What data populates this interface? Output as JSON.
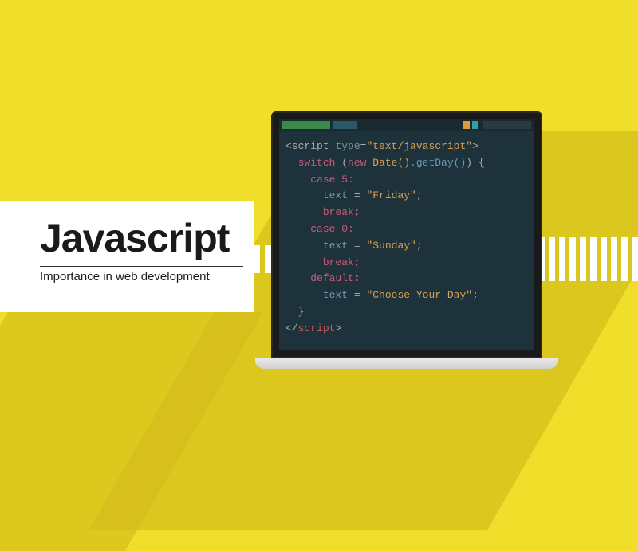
{
  "title": "Javascript",
  "subtitle": "Importance in web development",
  "code": {
    "l1_tag_open": "<script",
    "l1_attr": " type",
    "l1_eq": "=",
    "l1_val": "\"text/javascript\"",
    "l1_close": ">",
    "l2_kw": "switch",
    "l2_paren_open": " (",
    "l2_new": "new",
    "l2_class": " Date()",
    "l2_method": ".getDay()",
    "l2_paren_close": ") {",
    "l3": "case 5:",
    "l4_var": "text",
    "l4_eq": " = ",
    "l4_str": "\"Friday\"",
    "l4_end": ";",
    "l5": "break;",
    "l6": "case 0:",
    "l7_var": "text",
    "l7_eq": " = ",
    "l7_str": "\"Sunday\"",
    "l7_end": ";",
    "l8": "break;",
    "l9": "default:",
    "l10_var": "text",
    "l10_eq": " = ",
    "l10_str": "\"Choose Your Day\"",
    "l10_end": ";",
    "l11": "}",
    "l12_open": "</",
    "l12_tag": "script",
    "l12_close": ">"
  }
}
